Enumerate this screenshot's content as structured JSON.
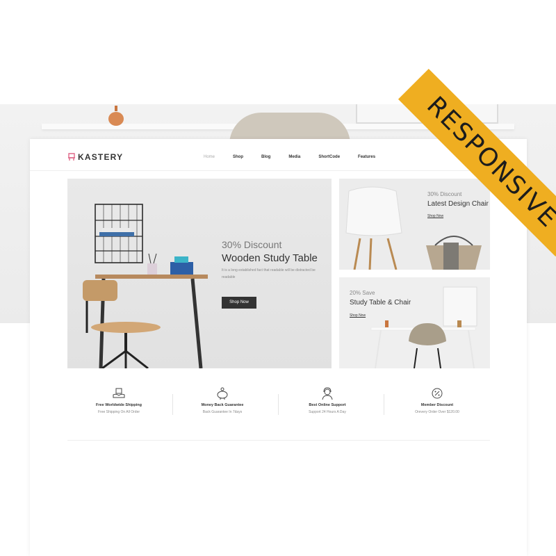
{
  "brand": {
    "name": "KASTERY"
  },
  "nav": {
    "items": [
      {
        "label": "Home",
        "active": true
      },
      {
        "label": "Shop",
        "active": false
      },
      {
        "label": "Blog",
        "active": false
      },
      {
        "label": "Media",
        "active": false
      },
      {
        "label": "ShortCode",
        "active": false
      },
      {
        "label": "Features",
        "active": false
      }
    ]
  },
  "hero": {
    "discount": "30% Discount",
    "title": "Wooden Study Table",
    "description": "It is a long established fact that readable will be distracted be readable",
    "button": "Shop Now"
  },
  "banners": [
    {
      "discount": "30% Discount",
      "title": "Latest Design Chair",
      "link": "Shop Now"
    },
    {
      "discount": "20% Save",
      "title": "Study Table & Chair",
      "link": "Shop Now"
    }
  ],
  "features": [
    {
      "icon": "shipping-hands-icon",
      "title": "Free Worldwide Shipping",
      "subtitle": "Free Shipping On All Order"
    },
    {
      "icon": "piggy-bank-icon",
      "title": "Money Back Guarantee",
      "subtitle": "Back Guarantee In 7days"
    },
    {
      "icon": "support-agent-icon",
      "title": "Best Online Support",
      "subtitle": "Support 24 Hours A Day"
    },
    {
      "icon": "discount-badge-icon",
      "title": "Member Discount",
      "subtitle": "Orevery Order Over $120.00"
    }
  ],
  "ribbon": {
    "text": "RESPONSIVE"
  },
  "colors": {
    "ribbon": "#efae21",
    "logo_accent": "#e0698a",
    "button": "#333333"
  }
}
